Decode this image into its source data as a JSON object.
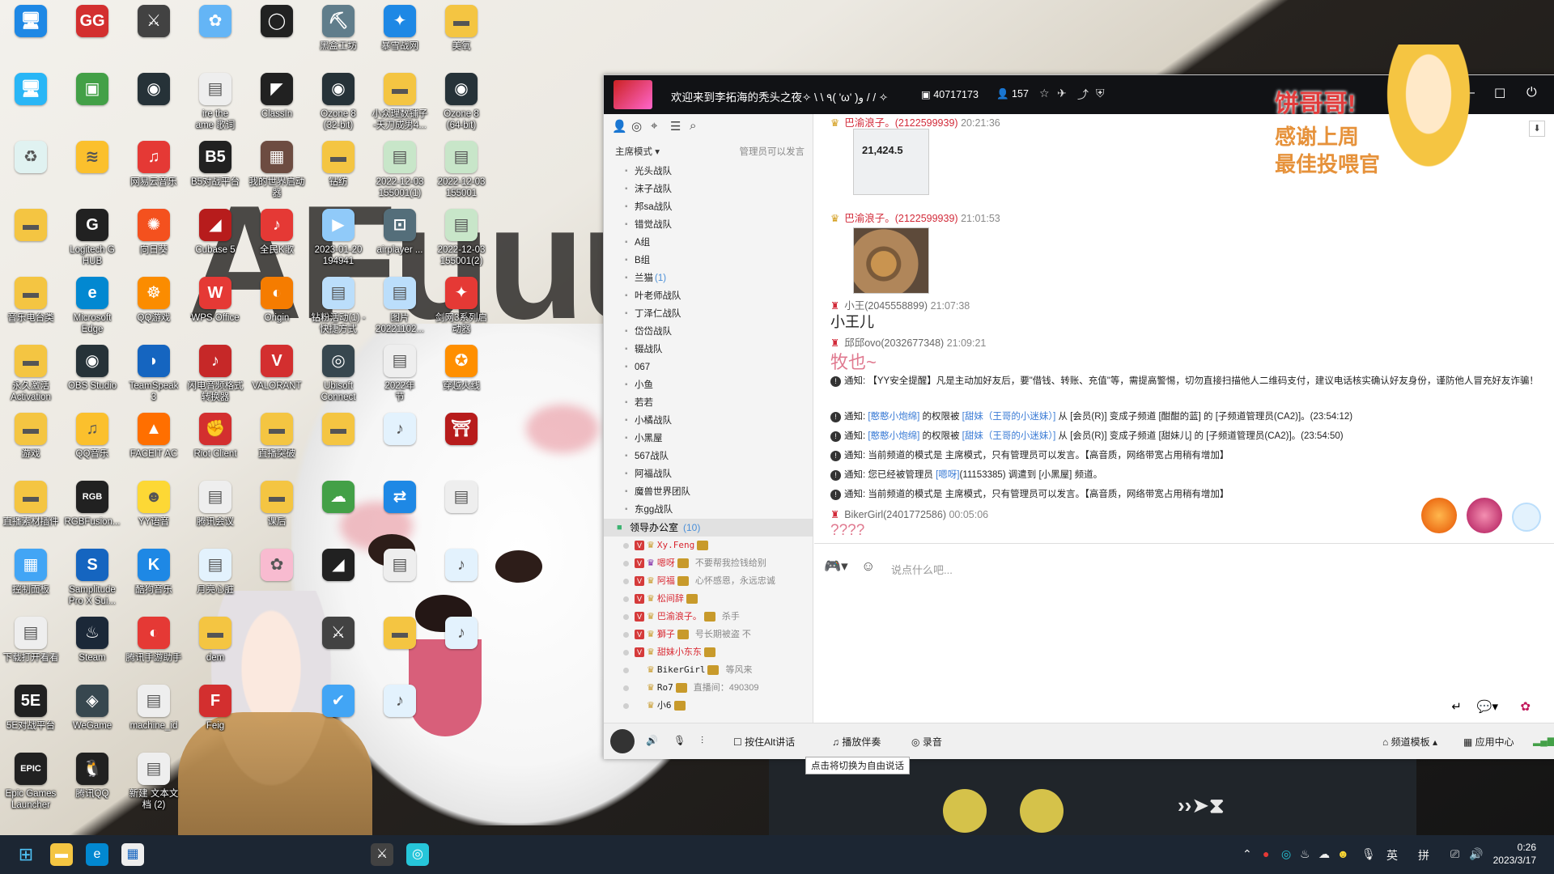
{
  "desktop": {
    "icons": [
      {
        "label": "",
        "glyph": "🖥",
        "color": "#1e88e5"
      },
      {
        "label": "",
        "glyph": "GG",
        "color": "#d32f2f"
      },
      {
        "label": "",
        "glyph": "⚔",
        "color": "#424242"
      },
      {
        "label": "",
        "glyph": "✿",
        "color": "#64b5f6"
      },
      {
        "label": "",
        "glyph": "◯",
        "color": "#212121"
      },
      {
        "label": "黑盒工坊",
        "glyph": "⛏",
        "color": "#607d8b"
      },
      {
        "label": "暴雪战网",
        "glyph": "✦",
        "color": "#1e88e5"
      },
      {
        "label": "美氧",
        "glyph": "▬",
        "color": "#f4c542"
      },
      {
        "label": "",
        "glyph": "🖥",
        "color": "#29b6f6"
      },
      {
        "label": "",
        "glyph": "▣",
        "color": "#43a047"
      },
      {
        "label": "",
        "glyph": "◉",
        "color": "#263238"
      },
      {
        "label": "ire the\name 歌词",
        "glyph": "▤",
        "color": "#eeeeee"
      },
      {
        "label": "ClassIn",
        "glyph": "◤",
        "color": "#212121"
      },
      {
        "label": "Ozone 8\n(32-bit)",
        "glyph": "◉",
        "color": "#263238"
      },
      {
        "label": "小众理数铺子\n-天刀成男4...",
        "glyph": "▬",
        "color": "#f4c542"
      },
      {
        "label": "Ozone 8\n(64-bit)",
        "glyph": "◉",
        "color": "#263238"
      },
      {
        "label": "",
        "glyph": "♻",
        "color": "#e0f2f1"
      },
      {
        "label": "",
        "glyph": "≋",
        "color": "#fbc02d"
      },
      {
        "label": "网易云音乐",
        "glyph": "♫",
        "color": "#e53935"
      },
      {
        "label": "B5对战平台",
        "glyph": "B5",
        "color": "#212121"
      },
      {
        "label": "我的世界启动\n器",
        "glyph": "▦",
        "color": "#6d4c41"
      },
      {
        "label": "钻纺",
        "glyph": "▬",
        "color": "#f4c542"
      },
      {
        "label": "2022-12-03\n155001(1)",
        "glyph": "▤",
        "color": "#c8e6c9"
      },
      {
        "label": "2022-12-03\n155001",
        "glyph": "▤",
        "color": "#c8e6c9"
      },
      {
        "label": "",
        "glyph": "▬",
        "color": "#f4c542"
      },
      {
        "label": "Logitech G\nHUB",
        "glyph": "G",
        "color": "#212121"
      },
      {
        "label": "向日葵",
        "glyph": "✺",
        "color": "#f4511e"
      },
      {
        "label": "Cubase 5",
        "glyph": "◢",
        "color": "#b71c1c"
      },
      {
        "label": "全民K歌",
        "glyph": "♪",
        "color": "#e53935"
      },
      {
        "label": "2023-01-20\n194941",
        "glyph": "▶",
        "color": "#90caf9"
      },
      {
        "label": "airplayer ...",
        "glyph": "⊡",
        "color": "#546e7a"
      },
      {
        "label": "2022-12-03\n155001(2)",
        "glyph": "▤",
        "color": "#c8e6c9"
      },
      {
        "label": "音乐电台类",
        "glyph": "▬",
        "color": "#f4c542"
      },
      {
        "label": "Microsoft\nEdge",
        "glyph": "e",
        "color": "#0288d1"
      },
      {
        "label": "QQ游戏",
        "glyph": "☸",
        "color": "#fb8c00"
      },
      {
        "label": "WPS Office",
        "glyph": "W",
        "color": "#e53935"
      },
      {
        "label": "Origin",
        "glyph": "◐",
        "color": "#f57c00"
      },
      {
        "label": "钻粉活动(1) -\n快捷方式",
        "glyph": "▤",
        "color": "#bbdefb"
      },
      {
        "label": "图片\n20221102...",
        "glyph": "▤",
        "color": "#bbdefb"
      },
      {
        "label": "剑网3系列启\n动器",
        "glyph": "✦",
        "color": "#e53935"
      },
      {
        "label": "永久激活\nActivation",
        "glyph": "▬",
        "color": "#f4c542"
      },
      {
        "label": "OBS Studio",
        "glyph": "◉",
        "color": "#263238"
      },
      {
        "label": "TeamSpeak\n3",
        "glyph": "◗",
        "color": "#1565c0"
      },
      {
        "label": "闪电音频格式\n转换器",
        "glyph": "♪",
        "color": "#c62828"
      },
      {
        "label": "VALORANT",
        "glyph": "V",
        "color": "#d32f2f"
      },
      {
        "label": "Ubisoft\nConnect",
        "glyph": "◎",
        "color": "#37474f"
      },
      {
        "label": "2022年\n节",
        "glyph": "▤",
        "color": "#eeeeee"
      },
      {
        "label": "穿越火线",
        "glyph": "✪",
        "color": "#ff8f00"
      },
      {
        "label": "游戏",
        "glyph": "▬",
        "color": "#f4c542"
      },
      {
        "label": "QQ音乐",
        "glyph": "♫",
        "color": "#fbc02d"
      },
      {
        "label": "FACEIT AC",
        "glyph": "▲",
        "color": "#ff6f00"
      },
      {
        "label": "Riot Client",
        "glyph": "✊",
        "color": "#d32f2f"
      },
      {
        "label": "直播突破",
        "glyph": "▬",
        "color": "#f4c542"
      },
      {
        "label": "",
        "glyph": "▬",
        "color": "#f4c542"
      },
      {
        "label": "",
        "glyph": "♪",
        "color": "#e3f2fd"
      },
      {
        "label": "",
        "glyph": "⛩",
        "color": "#b71c1c"
      },
      {
        "label": "直播素材插件",
        "glyph": "▬",
        "color": "#f4c542"
      },
      {
        "label": "RGBFusion...",
        "glyph": "RGB",
        "color": "#212121"
      },
      {
        "label": "YY语音",
        "glyph": "☻",
        "color": "#fdd835"
      },
      {
        "label": "腾讯会议",
        "glyph": "▤",
        "color": "#eeeeee"
      },
      {
        "label": "课后",
        "glyph": "▬",
        "color": "#f4c542"
      },
      {
        "label": "",
        "glyph": "☁",
        "color": "#43a047"
      },
      {
        "label": "",
        "glyph": "⇄",
        "color": "#1e88e5"
      },
      {
        "label": "",
        "glyph": "▤",
        "color": "#eeeeee"
      },
      {
        "label": "控制面板",
        "glyph": "▦",
        "color": "#42a5f5"
      },
      {
        "label": "Samplitude\nPro X Sui...",
        "glyph": "S",
        "color": "#1565c0"
      },
      {
        "label": "酷狗音乐",
        "glyph": "K",
        "color": "#1e88e5"
      },
      {
        "label": "月亮心脏",
        "glyph": "▤",
        "color": "#e3f2fd"
      },
      {
        "label": "",
        "glyph": "✿",
        "color": "#f8bbd0"
      },
      {
        "label": "",
        "glyph": "◢",
        "color": "#212121"
      },
      {
        "label": "",
        "glyph": "▤",
        "color": "#eeeeee"
      },
      {
        "label": "",
        "glyph": "♪",
        "color": "#e3f2fd"
      },
      {
        "label": "下载打开看看",
        "glyph": "▤",
        "color": "#eeeeee"
      },
      {
        "label": "Steam",
        "glyph": "♨",
        "color": "#1b2838"
      },
      {
        "label": "腾讯手游助手",
        "glyph": "◐",
        "color": "#e53935"
      },
      {
        "label": "dem",
        "glyph": "▬",
        "color": "#f4c542"
      },
      {
        "label": "",
        "glyph": "",
        "color": "transparent"
      },
      {
        "label": "",
        "glyph": "⚔",
        "color": "#424242"
      },
      {
        "label": "",
        "glyph": "▬",
        "color": "#f4c542"
      },
      {
        "label": "",
        "glyph": "♪",
        "color": "#e3f2fd"
      },
      {
        "label": "5E对战平台",
        "glyph": "5E",
        "color": "#212121"
      },
      {
        "label": "WeGame",
        "glyph": "◈",
        "color": "#37474f"
      },
      {
        "label": "machine_id",
        "glyph": "▤",
        "color": "#eeeeee"
      },
      {
        "label": "Feig",
        "glyph": "F",
        "color": "#d32f2f"
      },
      {
        "label": "",
        "glyph": "",
        "color": "transparent"
      },
      {
        "label": "",
        "glyph": "✔",
        "color": "#42a5f5"
      },
      {
        "label": "",
        "glyph": "♪",
        "color": "#e3f2fd"
      },
      {
        "label": "",
        "glyph": "",
        "color": "transparent"
      },
      {
        "label": "Epic Games\nLauncher",
        "glyph": "EPIC",
        "color": "#212121"
      },
      {
        "label": "腾讯QQ",
        "glyph": "🐧",
        "color": "#212121"
      },
      {
        "label": "新建 文本文\n档 (2)",
        "glyph": "▤",
        "color": "#eeeeee"
      }
    ]
  },
  "chat": {
    "title": "欢迎来到李拓海的秃头之夜✧ \\ \\ ٩( 'ω' )و / / ✧",
    "channel_id": "40717173",
    "online_count": "157",
    "tree": {
      "mode": "主席模式",
      "mode_note": "管理员可以发言",
      "channels": [
        {
          "name": "光头战队",
          "count": ""
        },
        {
          "name": "沫子战队",
          "count": ""
        },
        {
          "name": "邦sa战队",
          "count": ""
        },
        {
          "name": "错觉战队",
          "count": ""
        },
        {
          "name": "A组",
          "count": ""
        },
        {
          "name": "B组",
          "count": ""
        },
        {
          "name": "兰猫",
          "count": "(1)"
        },
        {
          "name": "叶老师战队",
          "count": ""
        },
        {
          "name": "丁泽仁战队",
          "count": ""
        },
        {
          "name": "岱岱战队",
          "count": ""
        },
        {
          "name": "辍战队",
          "count": ""
        },
        {
          "name": "067",
          "count": ""
        },
        {
          "name": "小鱼",
          "count": ""
        },
        {
          "name": "若若",
          "count": ""
        },
        {
          "name": "小橘战队",
          "count": ""
        },
        {
          "name": "小黑屋",
          "count": ""
        },
        {
          "name": "567战队",
          "count": ""
        },
        {
          "name": "阿福战队",
          "count": ""
        },
        {
          "name": "魔兽世界团队",
          "count": ""
        },
        {
          "name": "东gg战队",
          "count": ""
        }
      ],
      "office": {
        "name": "领导办公室",
        "count": "(10)"
      },
      "members": [
        {
          "name": "Xy.Feng",
          "sig": "",
          "red": true
        },
        {
          "name": "嗯呀",
          "sig": "不要帮我捡钱给别",
          "red": true
        },
        {
          "name": "阿福",
          "sig": "心怀感恩，永远忠诚",
          "red": true
        },
        {
          "name": "松间辞",
          "sig": "",
          "red": true
        },
        {
          "name": "巴渝浪子。",
          "sig": "杀手",
          "red": true
        },
        {
          "name": "獅子",
          "sig": "号长期被盗 不",
          "red": true
        },
        {
          "name": "甜妹小东东",
          "sig": "",
          "red": true
        },
        {
          "name": "BikerGirl",
          "sig": "等风来",
          "red": false
        },
        {
          "name": "Ro7",
          "sig": "直播间：490309",
          "red": false
        },
        {
          "name": "小6",
          "sig": "",
          "red": false
        }
      ]
    },
    "messages": {
      "m1": {
        "user": "巴渝浪子。(2122599939)",
        "time": "20:21:36"
      },
      "m1_img": "21,424.5",
      "m2": {
        "user": "巴渝浪子。(2122599939)",
        "time": "21:01:53"
      },
      "m3": {
        "user": "小王(2045558899)",
        "time": "21:07:38",
        "text": "小王儿"
      },
      "m4": {
        "user": "邱邱ovo(2032677348)",
        "time": "21:09:21",
        "text": "牧也~"
      },
      "n1": "通知: 【YY安全提醒】凡是主动加好友后，要\"借钱、转账、充值\"等，需提高警惕，切勿直接扫描他人二维码支付，建议电话核实确认好友身份，谨防他人冒充好友诈骗！",
      "n2_pre": "通知: ",
      "n2_a": "[憨憨小炮绵]",
      "n2_mid": " 的权限被 ",
      "n2_b": "[甜妹（王哥的小迷妹）]",
      "n2_post": " 从 [会员(R)] 变成子频道 [酣酣的蓝] 的 [子频道管理员(CA2)]。(23:54:12)",
      "n3_pre": "通知: ",
      "n3_a": "[憨憨小炮绵]",
      "n3_mid": " 的权限被 ",
      "n3_b": "[甜妹（王哥的小迷妹）]",
      "n3_post": " 从 [会员(R)] 变成子频道 [甜妹儿] 的 [子频道管理员(CA2)]。(23:54:50)",
      "n4": "通知: 当前频道的模式是 主席模式，只有管理员可以发言。【高音质，网络带宽占用稍有增加】",
      "n5_pre": "通知: 您已经被管理员 ",
      "n5_a": "[嗯呀]",
      "n5_post": "(11153385) 调遣到 [小黑屋] 频道。",
      "n6": "通知: 当前频道的模式是 主席模式，只有管理员可以发言。【高音质，网络带宽占用稍有增加】",
      "m5": {
        "user": "BikerGirl(2401772586)",
        "time": "00:05:06",
        "text": "????"
      }
    },
    "input_placeholder": "说点什么吧...",
    "bottombar": {
      "push_to_talk": "按住Alt讲话",
      "play_music": "播放伴奏",
      "record": "录音",
      "template": "频道模板",
      "app_center": "应用中心",
      "tooltip": "点击将切换为自由说话"
    },
    "banner": {
      "line1": "饼哥哥!",
      "line2": "感谢上周",
      "line3": "最佳投喂官"
    }
  },
  "wallpaper_text": "AFuuu",
  "taskbar": {
    "time": "0:26",
    "date": "2023/3/17",
    "ime_lang": "英",
    "ime_mode": "拼"
  }
}
